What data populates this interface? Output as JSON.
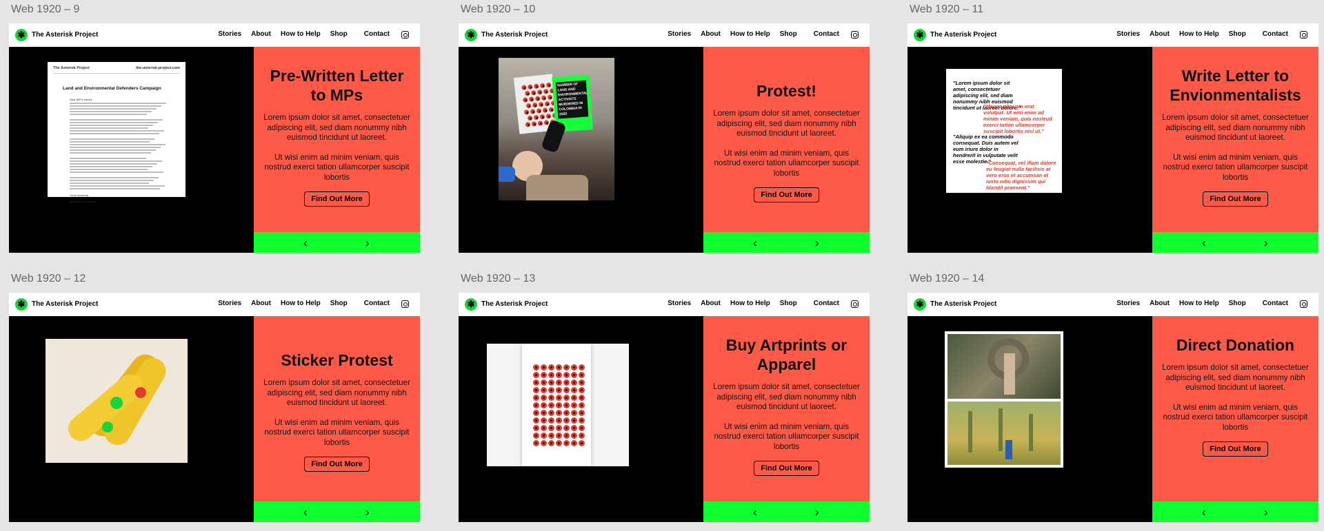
{
  "nav": {
    "brand": "The Asterisk Project",
    "links": [
      "Stories",
      "About",
      "How to Help",
      "Shop",
      "Contact"
    ]
  },
  "common": {
    "body1": "Lorem ipsum dolor sit amet, consectetuer adipiscing elit, sed diam nonummy nibh euismod tincidunt ut laoreet.",
    "body2": "Ut wisi enim ad minim veniam, quis nostrud exerci tation ullamcorper suscipit lobortis",
    "cta": "Find Out More",
    "prev": "‹",
    "next": "›"
  },
  "boards": [
    {
      "label": "Web 1920 – 9",
      "title": "Pre-Written Letter to MPs"
    },
    {
      "label": "Web 1920 – 10",
      "title": "Protest!"
    },
    {
      "label": "Web 1920 – 11",
      "title": "Write Letter to Envionmentalists"
    },
    {
      "label": "Web 1920 – 12",
      "title": "Sticker Protest"
    },
    {
      "label": "Web 1920 – 13",
      "title": "Buy Artprints or Apparel"
    },
    {
      "label": "Web 1920 – 14",
      "title": "Direct Donation"
    }
  ],
  "letter": {
    "brand": "The Asterisk Project",
    "url": "the-asterisk-project.com",
    "title": "Land and Environmental Defenders Campaign",
    "greeting": "Dear [MP's name],",
    "signoff": "Yours sincerely,",
    "signname": "[Name and Postcode]"
  },
  "poster": {
    "text": "NUMBER OF LAND AND ENVIRONMENTAL ACTIVISTS MURDERED IN COLOMBIA IN 2020"
  },
  "quotes": [
    {
      "text": "\"Lorem ipsum dolor sit amet, consectetuer adipiscing elit, sed diam nonummy nibh euismod tincidunt ut laoreet dolore.\"",
      "style": "black"
    },
    {
      "text": "\"Magna aliquam erat volutpat. Ut wisi enim ad minim veniam, quis nostrud exerci tation ullamcorper suscipit lobortis nisl ut.\"",
      "style": "red"
    },
    {
      "text": "\"Aliquip ex ea commodo consequat. Duis autem vel eum iriure dolor in hendrerit in vulputate velit esse molestie.\"",
      "style": "black"
    },
    {
      "text": "\"Consequat, vel illum dolore eu feugiat nulla facilisis at vero eros et accumsan et iusto odio dignissim qui blandit praesent.\"",
      "style": "red"
    }
  ],
  "colors": {
    "coral": "#ff5a47",
    "green": "#0dff2e",
    "black": "#000000",
    "brand_green": "#17d43a"
  }
}
